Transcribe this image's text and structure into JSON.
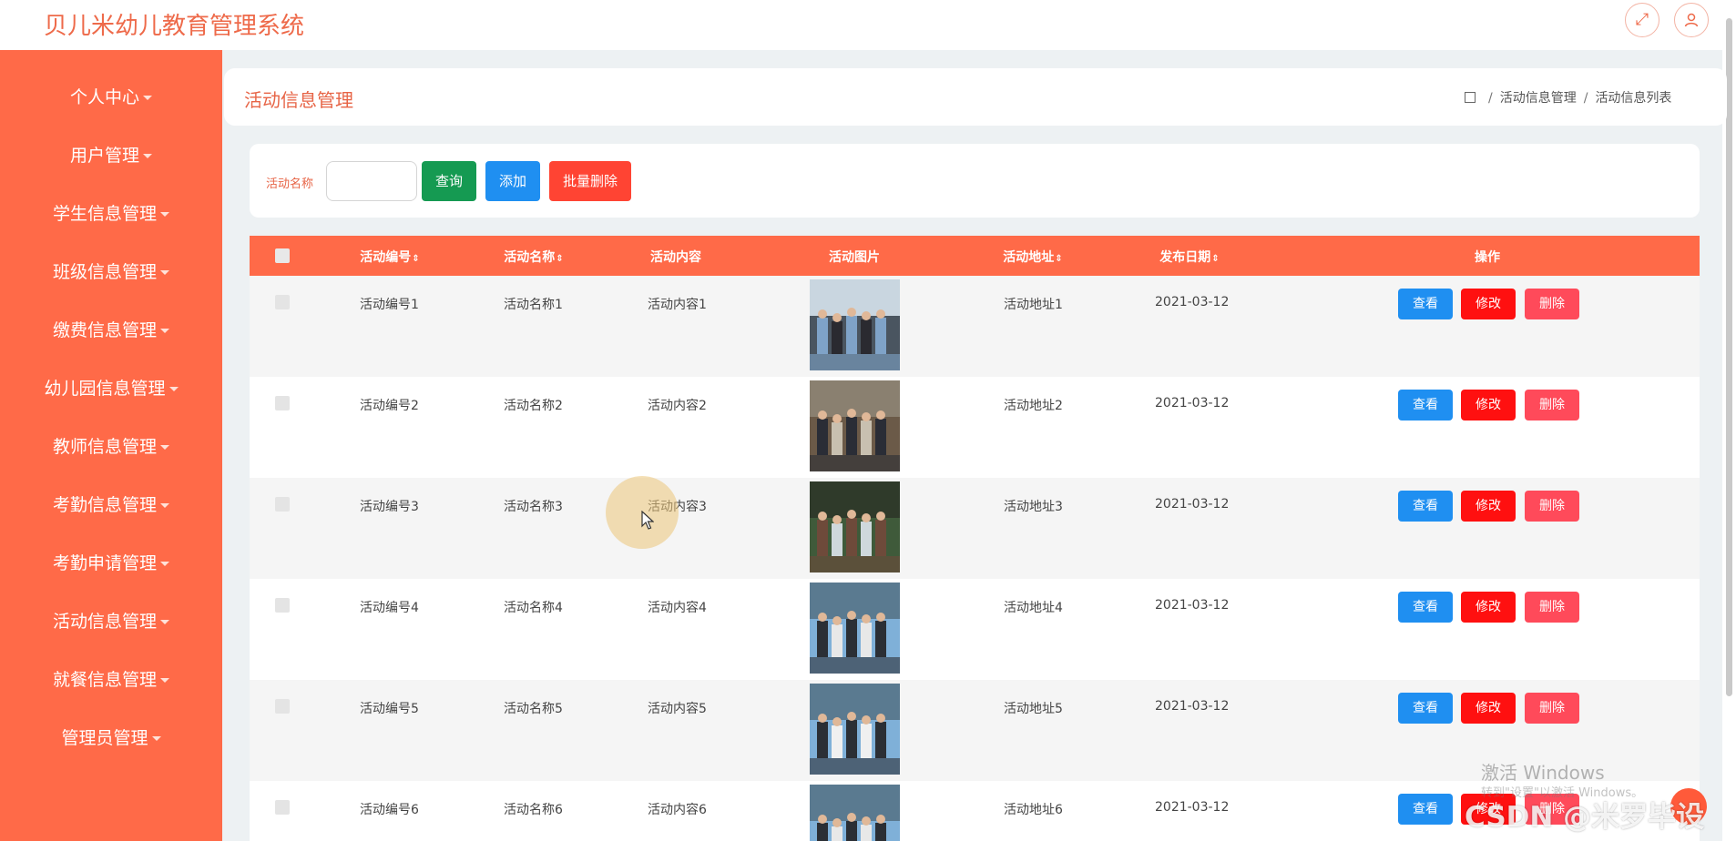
{
  "app": {
    "title": "贝儿米幼儿教育管理系统"
  },
  "sidebar": {
    "items": [
      {
        "label": "个人中心"
      },
      {
        "label": "用户管理"
      },
      {
        "label": "学生信息管理"
      },
      {
        "label": "班级信息管理"
      },
      {
        "label": "缴费信息管理"
      },
      {
        "label": "幼儿园信息管理"
      },
      {
        "label": "教师信息管理"
      },
      {
        "label": "考勤信息管理"
      },
      {
        "label": "考勤申请管理"
      },
      {
        "label": "活动信息管理"
      },
      {
        "label": "就餐信息管理"
      },
      {
        "label": "管理员管理"
      }
    ]
  },
  "page": {
    "title": "活动信息管理",
    "breadcrumb": [
      "活动信息管理",
      "活动信息列表"
    ]
  },
  "search": {
    "label": "活动名称",
    "value": "",
    "query_label": "查询",
    "add_label": "添加",
    "batch_delete_label": "批量删除"
  },
  "table": {
    "columns": [
      "活动编号",
      "活动名称",
      "活动内容",
      "活动图片",
      "活动地址",
      "发布日期",
      "操作"
    ],
    "sort_icon": "⇕",
    "rows": [
      {
        "id": "活动编号1",
        "name": "活动名称1",
        "content": "活动内容1",
        "address": "活动地址1",
        "date": "2021-03-12"
      },
      {
        "id": "活动编号2",
        "name": "活动名称2",
        "content": "活动内容2",
        "address": "活动地址2",
        "date": "2021-03-12"
      },
      {
        "id": "活动编号3",
        "name": "活动名称3",
        "content": "活动内容3",
        "address": "活动地址3",
        "date": "2021-03-12"
      },
      {
        "id": "活动编号4",
        "name": "活动名称4",
        "content": "活动内容4",
        "address": "活动地址4",
        "date": "2021-03-12"
      },
      {
        "id": "活动编号5",
        "name": "活动名称5",
        "content": "活动内容5",
        "address": "活动地址5",
        "date": "2021-03-12"
      },
      {
        "id": "活动编号6",
        "name": "活动名称6",
        "content": "活动内容6",
        "address": "活动地址6",
        "date": "2021-03-12"
      }
    ],
    "actions": {
      "view": "查看",
      "edit": "修改",
      "delete": "删除"
    }
  },
  "overlay": {
    "watermark": "激活 Windows",
    "watermark_sub": "转到\"设置\"以激活 Windows。",
    "csdn": "CSDN @米罗毕设"
  },
  "colors": {
    "accent": "#ff6a48",
    "title": "#ee6a4a",
    "query": "#159a52",
    "add": "#1f8ff1",
    "batch": "#ff4433",
    "edit": "#ff1010",
    "delete": "#ff4a5a"
  },
  "icons": {
    "fullscreen": "fullscreen-icon",
    "user": "user-icon",
    "home": "home-icon",
    "caret": "caret-down-icon"
  }
}
